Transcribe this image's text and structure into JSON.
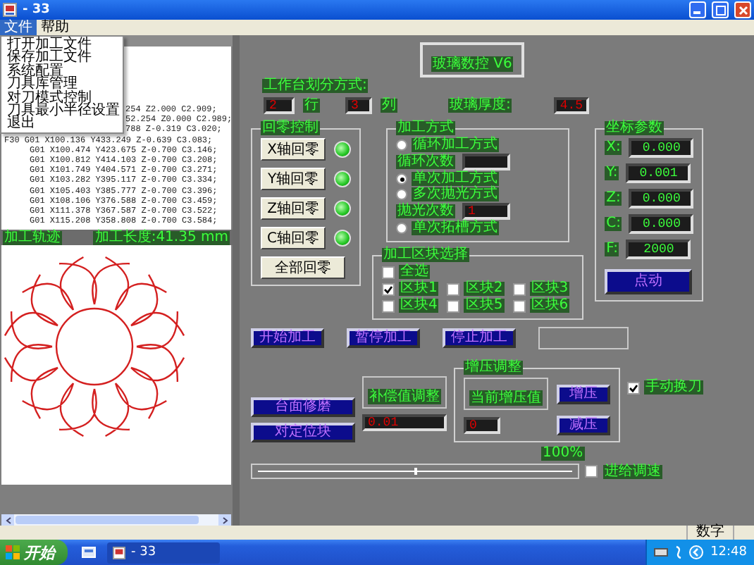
{
  "window": {
    "title": "- 33"
  },
  "menu_bar": [
    {
      "label": "文件",
      "selected": true
    },
    {
      "label": "帮助",
      "selected": false
    }
  ],
  "open_menu": {
    "items": [
      "打开加工文件",
      "保存加工文件",
      "系统配置",
      "刀具库管理",
      "对刀模式控制",
      "刀具最小半径设置",
      "退出"
    ]
  },
  "code_lines": [
    {
      "text": "254 Z2.000 C2.909;",
      "kind": "covered"
    },
    {
      "text": "52.254 Z0.000 C2.989;",
      "kind": "covered"
    },
    {
      "text": "788 Z-0.319 C3.020;",
      "kind": "covered"
    },
    {
      "text": "F30 G01 X100.136 Y433.249 Z-0.639 C3.083;",
      "kind": "plain"
    },
    {
      "text": "G01 X100.474 Y423.675 Z-0.700 C3.146;",
      "kind": "indented"
    },
    {
      "text": "G01 X100.812 Y414.103 Z-0.700 C3.208;",
      "kind": "indented"
    },
    {
      "text": "G01 X101.749 Y404.571 Z-0.700 C3.271;",
      "kind": "indented"
    },
    {
      "text": "G01 X103.282 Y395.117 Z-0.700 C3.334;",
      "kind": "indented"
    },
    {
      "text": "G01 X105.403 Y385.777 Z-0.700 C3.396;",
      "kind": "indented"
    },
    {
      "text": "G01 X108.106 Y376.588 Z-0.700 C3.459;",
      "kind": "indented"
    },
    {
      "text": "G01 X111.378 Y367.587 Z-0.700 C3.522;",
      "kind": "indented"
    },
    {
      "text": "G01 X115.208 Y358.808 Z-0.700 C3.584;",
      "kind": "indented"
    }
  ],
  "track_bar": {
    "left": "加工轨迹",
    "right": "加工长度:41.35 mm"
  },
  "right_panel": {
    "version": "玻璃数控 V6",
    "layout_label": "工作台划分方式:",
    "rows": {
      "value": "2",
      "unit": "行"
    },
    "columns": {
      "value": "3",
      "unit": "列"
    },
    "thickness": {
      "label": "玻璃厚度:",
      "value": "4.5"
    },
    "homing": {
      "title": "回零控制",
      "axes": [
        {
          "label": "X轴回零",
          "on": true
        },
        {
          "label": "Y轴回零",
          "on": true
        },
        {
          "label": "Z轴回零",
          "on": true
        },
        {
          "label": "C轴回零",
          "on": true
        }
      ],
      "all_button": "全部回零"
    },
    "mode": {
      "title": "加工方式",
      "items": [
        {
          "kind": "radio",
          "label": "循环加工方式",
          "selected": false
        },
        {
          "kind": "count",
          "label": "循环次数"
        },
        {
          "kind": "radio",
          "label": "单次加工方式",
          "selected": true
        },
        {
          "kind": "radio",
          "label": "多次抛光方式",
          "selected": false
        },
        {
          "kind": "count",
          "label": "抛光次数",
          "value": "1"
        },
        {
          "kind": "radio",
          "label": "单次拓槽方式",
          "selected": false
        }
      ]
    },
    "blocks": {
      "title": "加工区块选择",
      "all": {
        "label": "全选",
        "checked": false
      },
      "items": [
        {
          "label": "区块1",
          "checked": true
        },
        {
          "label": "区块2",
          "checked": false
        },
        {
          "label": "区块3",
          "checked": false
        },
        {
          "label": "区块4",
          "checked": false
        },
        {
          "label": "区块5",
          "checked": false
        },
        {
          "label": "区块6",
          "checked": false
        }
      ]
    },
    "coords": {
      "title": "坐标参数",
      "fields": [
        {
          "axis": "X:",
          "value": "0.000"
        },
        {
          "axis": "Y:",
          "value": "0.001"
        },
        {
          "axis": "Z:",
          "value": "0.000"
        },
        {
          "axis": "C:",
          "value": "0.000"
        },
        {
          "axis": "F:",
          "value": "2000"
        }
      ],
      "jog_button": "点动"
    },
    "actions": [
      "开始加工",
      "暂停加工",
      "停止加工"
    ],
    "grind_button": "台面修磨",
    "locate_button": "对定位块",
    "compensation": {
      "label": "补偿值调整",
      "value": "0.01"
    },
    "pressure": {
      "title": "增压调整",
      "label": "当前增压值",
      "value": "0",
      "increase": "增压",
      "decrease": "减压"
    },
    "manual_tool_change": {
      "label": "手动换刀",
      "checked": true
    },
    "feed": {
      "reading": "100%",
      "level": 0.5,
      "label": "进给调速",
      "checked": false
    }
  },
  "status_bar": {
    "mode": "数字"
  },
  "taskbar": {
    "start": "开始",
    "task": "- 33",
    "clock": "12:48"
  }
}
